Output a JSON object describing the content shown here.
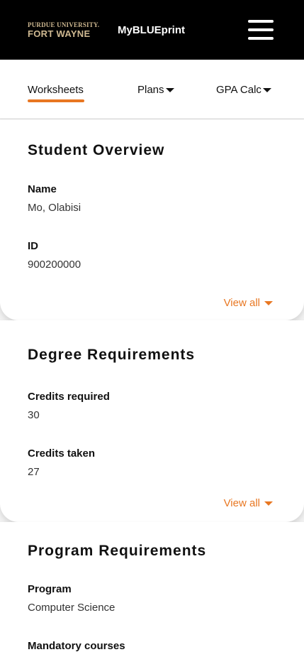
{
  "header": {
    "logo_line1": "PURDUE UNIVERSITY.",
    "logo_line2": "FORT WAYNE",
    "app_title": "MyBLUEprint",
    "menu_icon": "hamburger-menu-icon"
  },
  "nav": {
    "tabs": [
      {
        "label": "Worksheets",
        "active": true
      },
      {
        "label": "Plans",
        "dropdown": true
      },
      {
        "label": "GPA Calc",
        "dropdown": true
      }
    ]
  },
  "overview": {
    "title": "Student Overview",
    "fields": [
      {
        "label": "Name",
        "value": "Mo, Olabisi"
      },
      {
        "label": "ID",
        "value": "900200000"
      }
    ],
    "view_all": "View all"
  },
  "degree": {
    "title": "Degree Requirements",
    "fields": [
      {
        "label": "Credits required",
        "value": "30"
      },
      {
        "label": "Credits taken",
        "value": "27"
      }
    ],
    "view_all": "View all"
  },
  "program": {
    "title": "Program Requirements",
    "fields": [
      {
        "label": "Program",
        "value": "Computer Science"
      },
      {
        "label": "Mandatory courses",
        "value": ""
      }
    ]
  },
  "colors": {
    "accent": "#e87722",
    "header_bg": "#000000",
    "logo_gold": "#cfb991"
  }
}
